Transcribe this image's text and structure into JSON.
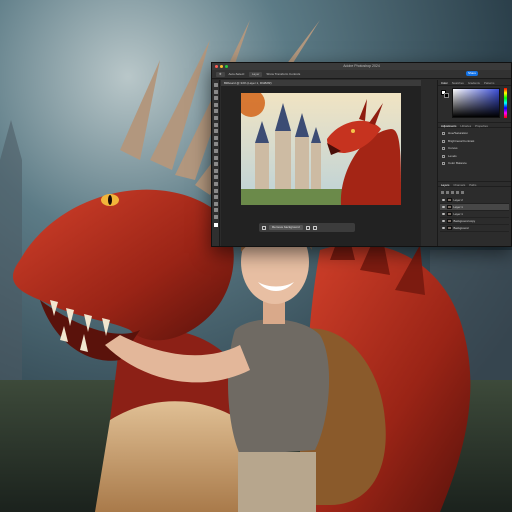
{
  "window": {
    "title": "Adobe Photoshop 2024",
    "share_label": "Share"
  },
  "options_bar": {
    "items": [
      "Auto-Select:",
      "Layer",
      "Show Transform Controls"
    ]
  },
  "document": {
    "tab_label": "Billboard @ 34% (Layer 1, RGB/8#)"
  },
  "context_bar": {
    "primary_action": "Remove background"
  },
  "panels": {
    "top_tabs": [
      "Color",
      "Swatches",
      "Gradients",
      "Patterns"
    ],
    "adjustment_tabs": [
      "Adjustments",
      "Libraries",
      "Properties"
    ],
    "adjustments": [
      "Hue/Saturation",
      "Brightness/Contrast",
      "Curves",
      "Levels",
      "Color Balance"
    ],
    "layer_tabs": [
      "Layers",
      "Channels",
      "Paths"
    ],
    "layers": [
      {
        "name": "Layer 2",
        "selected": false
      },
      {
        "name": "Layer 1",
        "selected": true
      },
      {
        "name": "Layer 1",
        "selected": false
      },
      {
        "name": "Background copy",
        "selected": false
      },
      {
        "name": "Background",
        "selected": false
      }
    ]
  },
  "colors": {
    "accent_blue": "#1473e6",
    "dragon_red": "#b52d1c",
    "panel_bg": "#2b2b2b"
  }
}
